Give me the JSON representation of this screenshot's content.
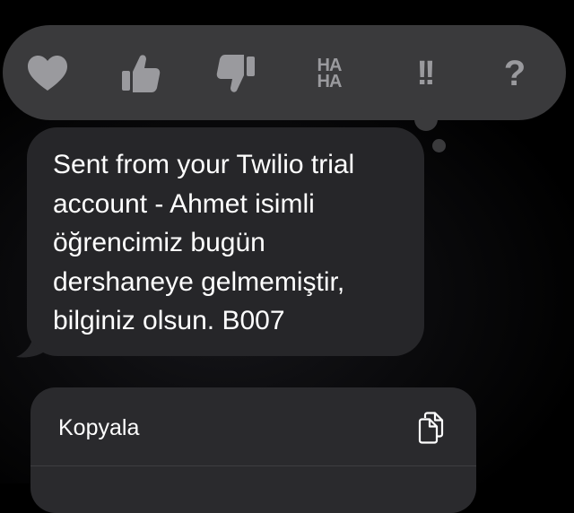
{
  "tapback": {
    "reactions": [
      {
        "icon": "heart-icon"
      },
      {
        "icon": "thumbs-up-icon"
      },
      {
        "icon": "thumbs-down-icon"
      },
      {
        "icon": "haha-icon",
        "line1": "HA",
        "line2": "HA"
      },
      {
        "icon": "exclamation-icon",
        "text": "!!"
      },
      {
        "icon": "question-icon",
        "text": "?"
      }
    ]
  },
  "message": {
    "text": "Sent from your Twilio trial\naccount - Ahmet isimli\nöğrencimiz bugün\ndershaneye gelmemiştir,\nbilginiz olsun. B007"
  },
  "context_menu": {
    "copy_label": "Kopyala"
  },
  "colors": {
    "tapback_bg": "#3a3a3c",
    "bubble_bg": "#262629",
    "menu_bg": "#2a2a2d",
    "icon_gray": "#9a9a9e"
  }
}
